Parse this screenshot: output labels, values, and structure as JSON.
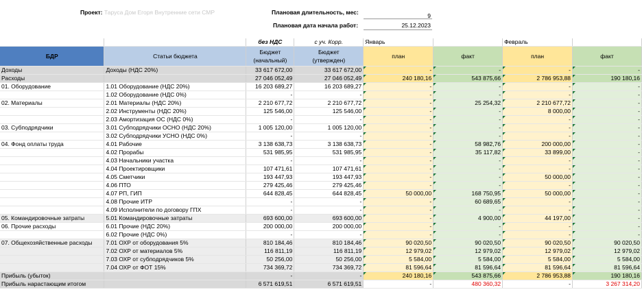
{
  "header": {
    "project_label": "Проект:",
    "project_value": "Таруса Дом Егоря Внутренние сети СМР",
    "duration_label": "Плановая длительность, мес:",
    "duration_value": "9",
    "start_label": "Плановая дата начала работ:",
    "start_value": "25.12.2023"
  },
  "columns": {
    "bdr": "БДР",
    "articles": "Статьи бюджета",
    "no_vat": "без НДС",
    "with_corr": "с уч. Корр.",
    "budget_initial": [
      "Бюджет",
      "(начальный)"
    ],
    "budget_approved": [
      "Бюджет",
      "(утвержден)"
    ],
    "month1": "Январь",
    "month2": "Февраль",
    "plan": "план",
    "fact": "факт"
  },
  "rows": [
    {
      "a": "Доходы",
      "b": "Доходы (НДС 20%)",
      "c": "33 617 672,00",
      "d": "33 617 672,00",
      "e": "-",
      "f": "-",
      "g": "-",
      "h": "-",
      "style": "gray"
    },
    {
      "a": "Расходы",
      "b": "",
      "c": "27 046 052,49",
      "d": "27 046 052,49",
      "e": "240 180,16",
      "f": "543 875,66",
      "g": "2 786 953,88",
      "h": "190 180,16",
      "style": "gray"
    },
    {
      "a": "01. Оборудование",
      "b": "1.01 Оборудование (НДС 20%)",
      "c": "16 203 689,27",
      "d": "16 203 689,27",
      "e": "-",
      "f": "-",
      "g": "-",
      "h": "-"
    },
    {
      "a": "",
      "b": "1.02 Оборудование (НДС 0%)",
      "c": "-",
      "d": "-",
      "e": "-",
      "f": "-",
      "g": "-",
      "h": "-"
    },
    {
      "a": "02. Материалы",
      "b": "2.01 Материалы (НДС 20%)",
      "c": "2 210 677,72",
      "d": "2 210 677,72",
      "e": "-",
      "f": "25 254,32",
      "g": "2 210 677,72",
      "h": "-",
      "top": true
    },
    {
      "a": "",
      "b": "2.02 Инструменты (НДС 20%)",
      "c": "125 546,00",
      "d": "125 546,00",
      "e": "-",
      "f": "-",
      "g": "8 000,00",
      "h": "-"
    },
    {
      "a": "",
      "b": "2.03 Амортизация ОС (НДС 0%)",
      "c": "-",
      "d": "-",
      "e": "-",
      "f": "-",
      "g": "-",
      "h": "-"
    },
    {
      "a": "03. Субподрядчики",
      "b": "3.01 Субподрядчики ОСНО (НДС 20%)",
      "c": "1 005 120,00",
      "d": "1 005 120,00",
      "e": "-",
      "f": "-",
      "g": "-",
      "h": "-",
      "top": true
    },
    {
      "a": "",
      "b": "3.02 Субподрядчики УСНО (НДС 0%)",
      "c": "-",
      "d": "-",
      "e": "-",
      "f": "-",
      "g": "-",
      "h": "-"
    },
    {
      "a": "04. Фонд оплаты труда",
      "b": "4.01 Рабочие",
      "c": "3 138 638,73",
      "d": "3 138 638,73",
      "e": "-",
      "f": "58 982,76",
      "g": "200 000,00",
      "h": "-",
      "top": true
    },
    {
      "a": "",
      "b": "4.02 Прорабы",
      "c": "531 985,95",
      "d": "531 985,95",
      "e": "-",
      "f": "35 117,82",
      "g": "33 899,00",
      "h": "-"
    },
    {
      "a": "",
      "b": "4.03 Начальники участка",
      "c": "-",
      "d": "-",
      "e": "-",
      "f": "-",
      "g": "-",
      "h": "-"
    },
    {
      "a": "",
      "b": "4.04 Проектировщики",
      "c": "107 471,61",
      "d": "107 471,61",
      "e": "-",
      "f": "-",
      "g": "-",
      "h": "-"
    },
    {
      "a": "",
      "b": "4.05 Сметчики",
      "c": "193 447,93",
      "d": "193 447,93",
      "e": "-",
      "f": "-",
      "g": "50 000,00",
      "h": "-"
    },
    {
      "a": "",
      "b": "4.06 ПТО",
      "c": "279 425,46",
      "d": "279 425,46",
      "e": "-",
      "f": "-",
      "g": "-",
      "h": "-"
    },
    {
      "a": "",
      "b": "4.07 РП, ГИП",
      "c": "644 828,45",
      "d": "644 828,45",
      "e": "50 000,00",
      "f": "168 750,95",
      "g": "50 000,00",
      "h": "-"
    },
    {
      "a": "",
      "b": "4.08 Прочие ИТР",
      "c": "-",
      "d": "-",
      "e": "-",
      "f": "60 689,65",
      "g": "-",
      "h": "-"
    },
    {
      "a": "",
      "b": "4.09 Исполнители по договору ГПХ",
      "c": "-",
      "d": "-",
      "e": "-",
      "f": "-",
      "g": "-",
      "h": "-"
    },
    {
      "a": "05. Командировочные затраты",
      "b": "5.01 Командировочные затраты",
      "c": "693 600,00",
      "d": "693 600,00",
      "e": "-",
      "f": "4 900,00",
      "g": "44 197,00",
      "h": "-",
      "top": true,
      "style": "lgray"
    },
    {
      "a": "06. Прочие расходы",
      "b": "6.01 Прочие (НДС 20%)",
      "c": "200 000,00",
      "d": "200 000,00",
      "e": "-",
      "f": "-",
      "g": "-",
      "h": "-",
      "top": true
    },
    {
      "a": "",
      "b": "6.02 Прочие (НДС 0%)",
      "c": "-",
      "d": "-",
      "e": "-",
      "f": "-",
      "g": "-",
      "h": "-"
    },
    {
      "a": "07. Общехозяйственные расходы",
      "b": "7.01 ОХР от оборудования 5%",
      "c": "810 184,46",
      "d": "810 184,46",
      "e": "90 020,50",
      "f": "90 020,50",
      "g": "90 020,50",
      "h": "90 020,50",
      "top": true,
      "style": "lgray"
    },
    {
      "a": "",
      "b": "7.02 ОХР от материалов 5%",
      "c": "116 811,19",
      "d": "116 811,19",
      "e": "12 979,02",
      "f": "12 979,02",
      "g": "12 979,02",
      "h": "12 979,02",
      "style": "lgray"
    },
    {
      "a": "",
      "b": "7.03 ОХР от субподрядчиков 5%",
      "c": "50 256,00",
      "d": "50 256,00",
      "e": "5 584,00",
      "f": "5 584,00",
      "g": "5 584,00",
      "h": "5 584,00",
      "style": "lgray"
    },
    {
      "a": "",
      "b": "7.04 ОХР от ФОТ 15%",
      "c": "734 369,72",
      "d": "734 369,72",
      "e": "81 596,64",
      "f": "81 596,64",
      "g": "81 596,64",
      "h": "81 596,64",
      "style": "lgray"
    },
    {
      "a": "Прибыль (убыток)",
      "b": "",
      "c": "-",
      "d": "-",
      "e": "240 180,16",
      "f": "543 875,66",
      "g": "2 786 953,88",
      "h": "190 180,16",
      "top": true,
      "style": "gray",
      "strong": true
    },
    {
      "a": "Прибыль нарастающим итогом",
      "b": "",
      "c": "6 571 619,51",
      "d": "6 571 619,51",
      "e": "-",
      "f": "480 360,32",
      "g": "-",
      "h": "3 267 314,20",
      "style": "gray",
      "redcols": [
        "f",
        "h"
      ],
      "final": true
    }
  ]
}
